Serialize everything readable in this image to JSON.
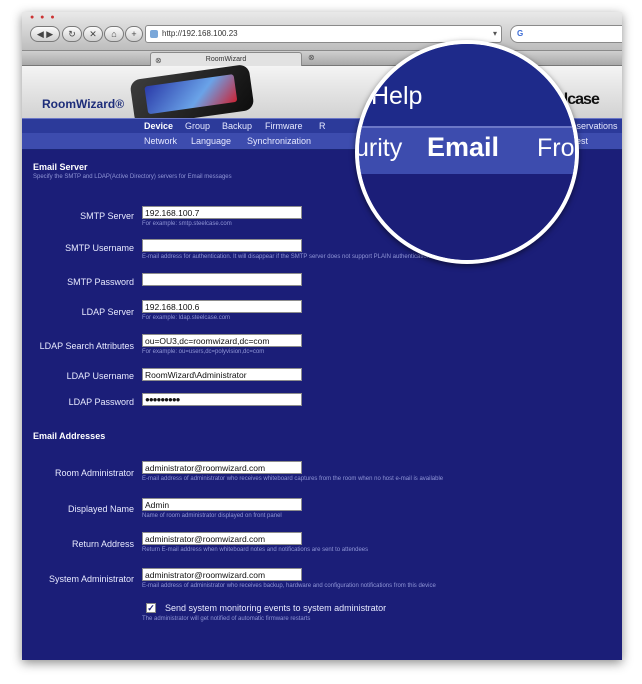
{
  "browser": {
    "url": "http://192.168.100.23",
    "tab_title": "RoomWizard",
    "search_prefix": "G"
  },
  "header": {
    "logo": "RoomWizard®",
    "brand": "Steelcase"
  },
  "menu_primary": [
    "Device",
    "Group",
    "Backup",
    "Firmware",
    "R"
  ],
  "menu_primary_right": "Reservations",
  "menu_secondary": [
    "Network",
    "Language",
    "Synchronization"
  ],
  "menu_secondary_right": "Self-test",
  "magnifier": {
    "top": "Help",
    "left": "urity",
    "center": "Email",
    "right": "Fro"
  },
  "email_server": {
    "title": "Email Server",
    "description": "Specify the SMTP and LDAP(Active Directory) servers for Email messages",
    "fields": [
      {
        "label": "SMTP Server",
        "value": "192.168.100.7",
        "hint": "For example: smtp.steelcase.com"
      },
      {
        "label": "SMTP Username",
        "value": "",
        "hint": "E-mail address for authentication. It will disappear if the SMTP server does not support PLAIN authentication"
      },
      {
        "label": "SMTP Password",
        "value": "",
        "hint": ""
      },
      {
        "label": "LDAP Server",
        "value": "192.168.100.6",
        "hint": "For example: ldap.steelcase.com"
      },
      {
        "label": "LDAP Search Attributes",
        "value": "ou=OU3,dc=roomwizard,dc=com",
        "hint": "For example: ou=users,dc=polyvision,dc=com"
      },
      {
        "label": "LDAP Username",
        "value": "RoomWizard\\Administrator",
        "hint": ""
      },
      {
        "label": "LDAP Password",
        "value": "●●●●●●●●●",
        "hint": ""
      }
    ]
  },
  "email_addresses": {
    "title": "Email Addresses",
    "fields": [
      {
        "label": "Room Administrator",
        "value": "administrator@roomwizard.com",
        "hint": "E-mail address of administrator who receives whiteboard captures from the room when no host e-mail is available"
      },
      {
        "label": "Displayed Name",
        "value": "Admin",
        "hint": "Name of room administrator displayed on front panel"
      },
      {
        "label": "Return Address",
        "value": "administrator@roomwizard.com",
        "hint": "Return E-mail address when whiteboard notes and notifications are sent to attendees"
      },
      {
        "label": "System Administrator",
        "value": "administrator@roomwizard.com",
        "hint": "E-mail address of administrator who receives backup, hardware and configuration notifications from this device"
      }
    ],
    "monitoring": {
      "checked": true,
      "label": "Send system monitoring events to system administrator",
      "hint": "The administrator will get notified of automatic firmware restarts"
    }
  }
}
